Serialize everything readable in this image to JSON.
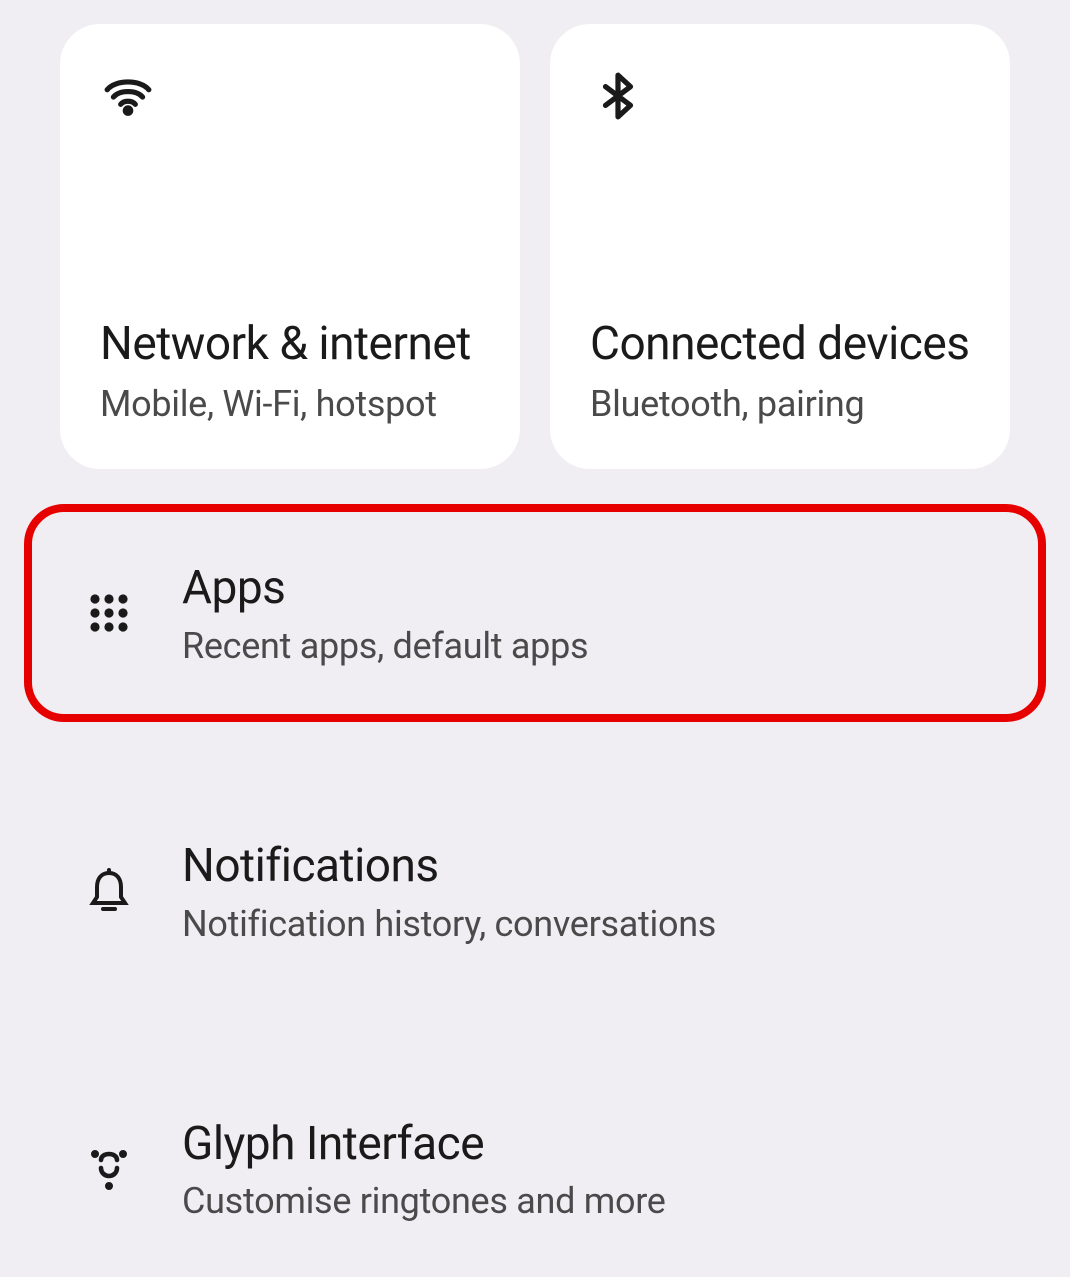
{
  "cards": {
    "network": {
      "title": "Network & internet",
      "subtitle": "Mobile, Wi-Fi, hotspot"
    },
    "connected_devices": {
      "title": "Connected devices",
      "subtitle": "Bluetooth, pairing"
    }
  },
  "list": {
    "apps": {
      "title": "Apps",
      "subtitle": "Recent apps, default apps",
      "highlighted": true
    },
    "notifications": {
      "title": "Notifications",
      "subtitle": "Notification history, conversations"
    },
    "glyph": {
      "title": "Glyph Interface",
      "subtitle": "Customise ringtones and more"
    }
  }
}
